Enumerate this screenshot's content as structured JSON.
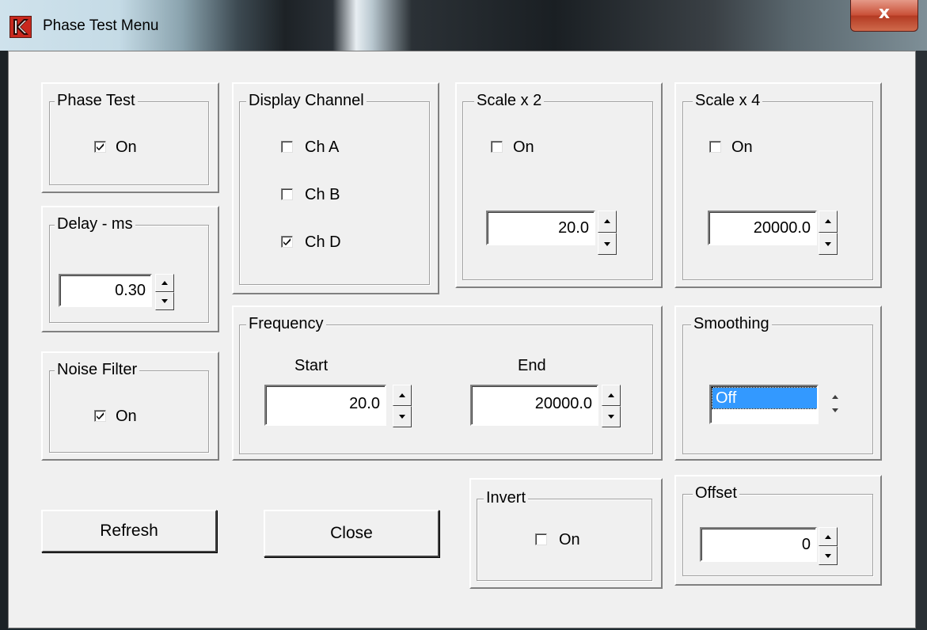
{
  "window": {
    "title": "Phase Test Menu",
    "close_glyph": "x"
  },
  "phase_test": {
    "legend": "Phase Test",
    "on_label": "On",
    "checked": true
  },
  "display_channel": {
    "legend": "Display Channel",
    "channels": [
      {
        "label": "Ch A",
        "checked": false
      },
      {
        "label": "Ch B",
        "checked": false
      },
      {
        "label": "Ch D",
        "checked": true
      }
    ]
  },
  "scale_x2": {
    "legend": "Scale x 2",
    "on_label": "On",
    "checked": false,
    "value": "20.0"
  },
  "scale_x4": {
    "legend": "Scale x 4",
    "on_label": "On",
    "checked": false,
    "value": "20000.0"
  },
  "delay": {
    "legend": "Delay - ms",
    "value": "0.30"
  },
  "frequency": {
    "legend": "Frequency",
    "start_label": "Start",
    "start_value": "20.0",
    "end_label": "End",
    "end_value": "20000.0"
  },
  "smoothing": {
    "legend": "Smoothing",
    "selected": "Off"
  },
  "noise_filter": {
    "legend": "Noise Filter",
    "on_label": "On",
    "checked": true
  },
  "buttons": {
    "refresh": "Refresh",
    "close": "Close"
  },
  "invert": {
    "legend": "Invert",
    "on_label": "On",
    "checked": false
  },
  "offset": {
    "legend": "Offset",
    "value": "0"
  }
}
